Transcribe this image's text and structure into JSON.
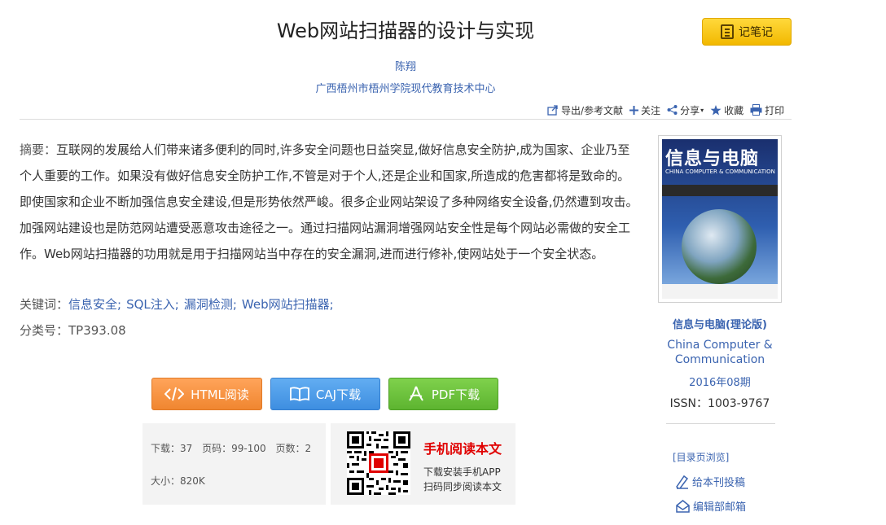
{
  "article": {
    "title": "Web网站扫描器的设计与实现",
    "author": "陈翔",
    "organization": "广西梧州市梧州学院现代教育技术中心"
  },
  "note_button": {
    "label": "记笔记",
    "icon": "notebook-icon"
  },
  "toolbar": {
    "export": "导出/参考文献",
    "follow": "关注",
    "share": "分享",
    "collect": "收藏",
    "print": "打印"
  },
  "abstract": {
    "label": "摘要：",
    "text": "互联网的发展给人们带来诸多便利的同时,许多安全问题也日益突显,做好信息安全防护,成为国家、企业乃至个人重要的工作。如果没有做好信息安全防护工作,不管是对于个人,还是企业和国家,所造成的危害都将是致命的。即使国家和企业不断加强信息安全建设,但是形势依然严峻。很多企业网站架设了多种网络安全设备,仍然遭到攻击。加强网站建设也是防范网站遭受恶意攻击途径之一。通过扫描网站漏洞增强网站安全性是每个网站必需做的安全工作。Web网站扫描器的功用就是用于扫描网站当中存在的安全漏洞,进而进行修补,使网站处于一个安全状态。"
  },
  "keywords": {
    "label": "关键词：",
    "items": [
      "信息安全;",
      "SQL注入;",
      "漏洞检测;",
      "Web网站扫描器;"
    ]
  },
  "classification": {
    "label": "分类号：",
    "value": "TP393.08"
  },
  "buttons": {
    "html_read": "HTML阅读",
    "caj_download": "CAJ下载",
    "pdf_download": "PDF下载"
  },
  "stats": {
    "downloads": "下载：37",
    "pages": "页码：99-100",
    "page_count": "页数：2",
    "size": "大小：820K"
  },
  "mobile": {
    "title": "手机阅读本文",
    "line1": "下载安装手机APP",
    "line2": "扫码同步阅读本文"
  },
  "journal": {
    "cover_title": "信息与电脑",
    "cover_subtitle": "CHINA COMPUTER & COMMUNICATION",
    "name": "信息与电脑(理论版)",
    "name_en": "China Computer & Communication",
    "issue": "2016年08期",
    "issn": "ISSN：1003-9767"
  },
  "side_links": {
    "toc": "[目录页浏览]",
    "submit": "给本刊投稿",
    "mailbox": "编辑部邮箱"
  },
  "colors": {
    "link": "#3b64b0",
    "note_button": "#f7c800",
    "html_button": "#f08630",
    "caj_button": "#3e8ee0",
    "pdf_button": "#5db430",
    "mobile_title": "#e00000"
  }
}
